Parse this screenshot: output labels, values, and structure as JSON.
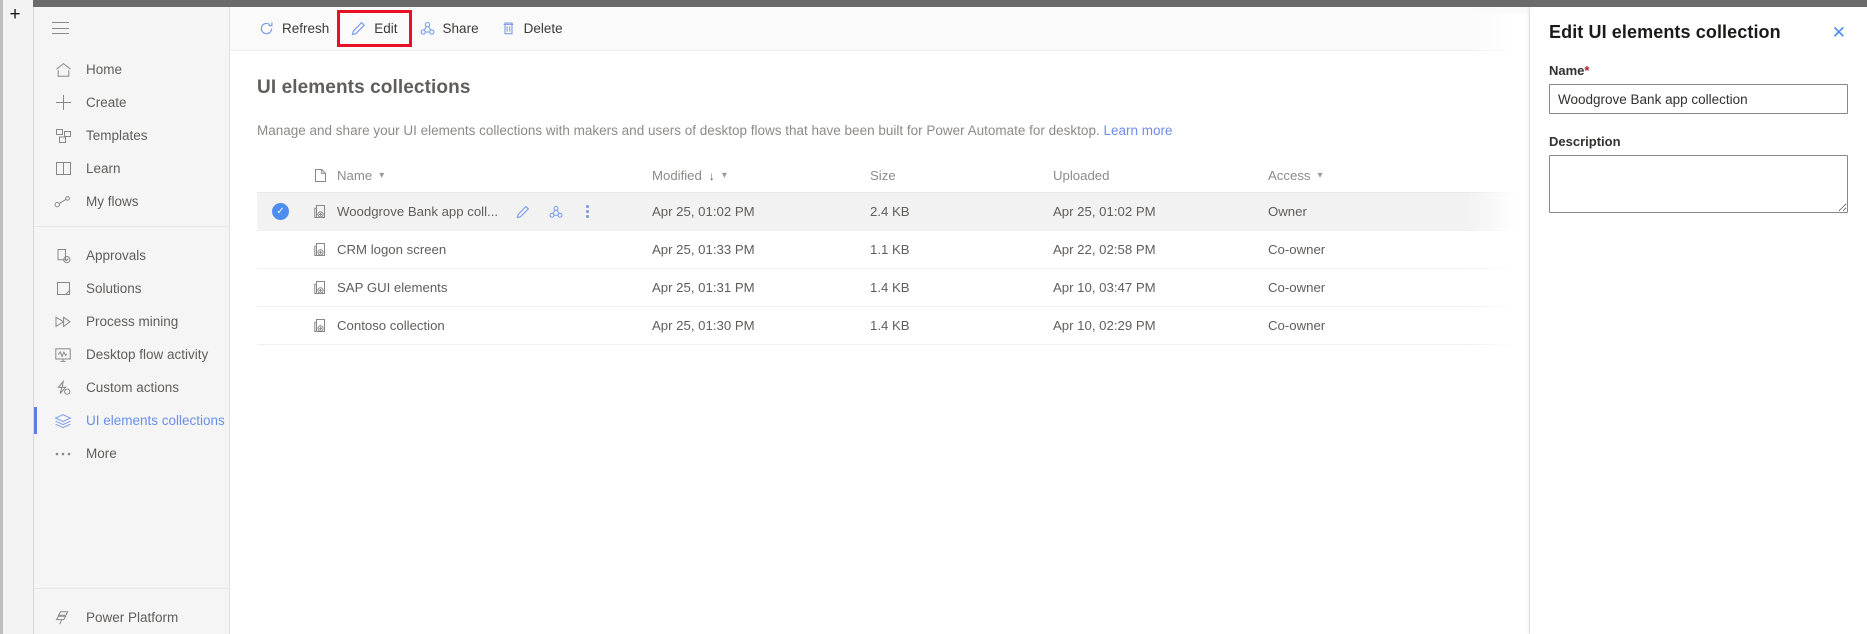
{
  "rail": {
    "add_label": "+"
  },
  "sidebar": {
    "menu_label": "Menu",
    "groups": [
      {
        "items": [
          {
            "label": "Home",
            "icon": "home-icon"
          },
          {
            "label": "Create",
            "icon": "plus-icon"
          },
          {
            "label": "Templates",
            "icon": "templates-icon"
          },
          {
            "label": "Learn",
            "icon": "learn-icon"
          },
          {
            "label": "My flows",
            "icon": "my-flows-icon"
          }
        ]
      },
      {
        "items": [
          {
            "label": "Approvals",
            "icon": "approvals-icon"
          },
          {
            "label": "Solutions",
            "icon": "solutions-icon"
          },
          {
            "label": "Process mining",
            "icon": "process-mining-icon"
          },
          {
            "label": "Desktop flow activity",
            "icon": "desktop-flow-activity-icon"
          },
          {
            "label": "Custom actions",
            "icon": "custom-actions-icon"
          },
          {
            "label": "UI elements collections",
            "icon": "ui-elements-collections-icon",
            "selected": true
          },
          {
            "label": "More",
            "icon": "more-icon"
          }
        ]
      }
    ],
    "footer": {
      "label": "Power Platform",
      "icon": "power-platform-icon"
    },
    "selected_accent": "#5b7ee0"
  },
  "commandbar": {
    "items": [
      {
        "label": "Refresh",
        "icon": "refresh-icon"
      },
      {
        "label": "Edit",
        "icon": "edit-pencil-icon",
        "highlighted": true
      },
      {
        "label": "Share",
        "icon": "share-icon"
      },
      {
        "label": "Delete",
        "icon": "trash-icon"
      }
    ],
    "highlight_color": "#e81123"
  },
  "page": {
    "title": "UI elements collections",
    "description": "Manage and share your UI elements collections with makers and users of desktop flows that have been built for Power Automate for desktop.",
    "learn_more": "Learn more"
  },
  "table": {
    "columns": {
      "type": "File type",
      "name": "Name",
      "modified": "Modified",
      "size": "Size",
      "uploaded": "Uploaded",
      "access": "Access"
    },
    "sort": {
      "column": "Modified",
      "direction": "descending",
      "glyph": "↓"
    },
    "rows": [
      {
        "selected": true,
        "name": "Woodgrove Bank app coll...",
        "modified": "Apr 25, 01:02 PM",
        "size": "2.4 KB",
        "uploaded": "Apr 25, 01:02 PM",
        "access": "Owner",
        "actions": [
          "edit-pencil-icon",
          "share-icon",
          "more-vertical-icon"
        ]
      },
      {
        "selected": false,
        "name": "CRM logon screen",
        "modified": "Apr 25, 01:33 PM",
        "size": "1.1 KB",
        "uploaded": "Apr 22, 02:58 PM",
        "access": "Co-owner",
        "actions": []
      },
      {
        "selected": false,
        "name": "SAP GUI elements",
        "modified": "Apr 25, 01:31 PM",
        "size": "1.4 KB",
        "uploaded": "Apr 10, 03:47 PM",
        "access": "Co-owner",
        "actions": []
      },
      {
        "selected": false,
        "name": "Contoso collection",
        "modified": "Apr 25, 01:30 PM",
        "size": "1.4 KB",
        "uploaded": "Apr 10, 02:29 PM",
        "access": "Co-owner",
        "actions": []
      }
    ]
  },
  "panel": {
    "title": "Edit UI elements collection",
    "close_label": "✕",
    "name_label": "Name",
    "name_required_mark": "*",
    "name_value": "Woodgrove Bank app collection",
    "name_placeholder": "",
    "description_label": "Description",
    "description_value": "",
    "description_placeholder": ""
  }
}
